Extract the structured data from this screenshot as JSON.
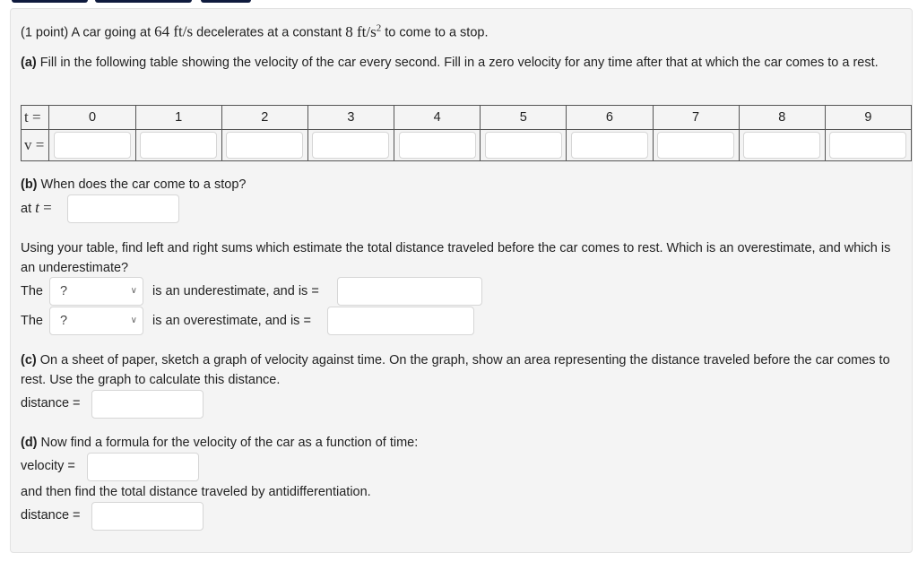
{
  "problem": {
    "points": "(1 point)",
    "intro_before_speed": "A car going at",
    "speed_value": "64",
    "speed_unit": "ft/s",
    "intro_middle": "decelerates at a constant",
    "decel_value": "8",
    "decel_unit": "ft/s",
    "decel_exp": "2",
    "intro_after": "to come to a stop."
  },
  "part_a": {
    "label": "(a)",
    "text": "Fill in the following table showing the velocity of the car every second. Fill in a zero velocity for any time after that at which the car comes to a rest.",
    "row_t_label": "t =",
    "row_v_label": "v =",
    "times": [
      "0",
      "1",
      "2",
      "3",
      "4",
      "5",
      "6",
      "7",
      "8",
      "9"
    ],
    "velocities": [
      "",
      "",
      "",
      "",
      "",
      "",
      "",
      "",
      "",
      ""
    ]
  },
  "part_b": {
    "label": "(b)",
    "question": "When does the car come to a stop?",
    "answer_prefix": "at",
    "answer_var": "t",
    "answer_eq": "=",
    "answer_value": "",
    "sums_text": "Using your table, find left and right sums which estimate the total distance traveled before the car comes to rest. Which is an overestimate, and which is an underestimate?",
    "rows": [
      {
        "prefix": "The",
        "select_value": "?",
        "suffix": "is an underestimate, and is =",
        "value": ""
      },
      {
        "prefix": "The",
        "select_value": "?",
        "suffix": "is an overestimate, and is =",
        "value": ""
      }
    ]
  },
  "part_c": {
    "label": "(c)",
    "text": "On a sheet of paper, sketch a graph of velocity against time. On the graph, show an area representing the distance traveled before the car comes to rest. Use the graph to calculate this distance.",
    "distance_label": "distance =",
    "distance_value": ""
  },
  "part_d": {
    "label": "(d)",
    "text": "Now find a formula for the velocity of the car as a function of time:",
    "velocity_label": "velocity =",
    "velocity_value": "",
    "followup": "and then find the total distance traveled by antidifferentiation.",
    "distance_label": "distance =",
    "distance_value": ""
  },
  "colors": {
    "panel_bg": "#f4f4f4",
    "top_tab": "#0e1a3d",
    "text": "#222222"
  }
}
